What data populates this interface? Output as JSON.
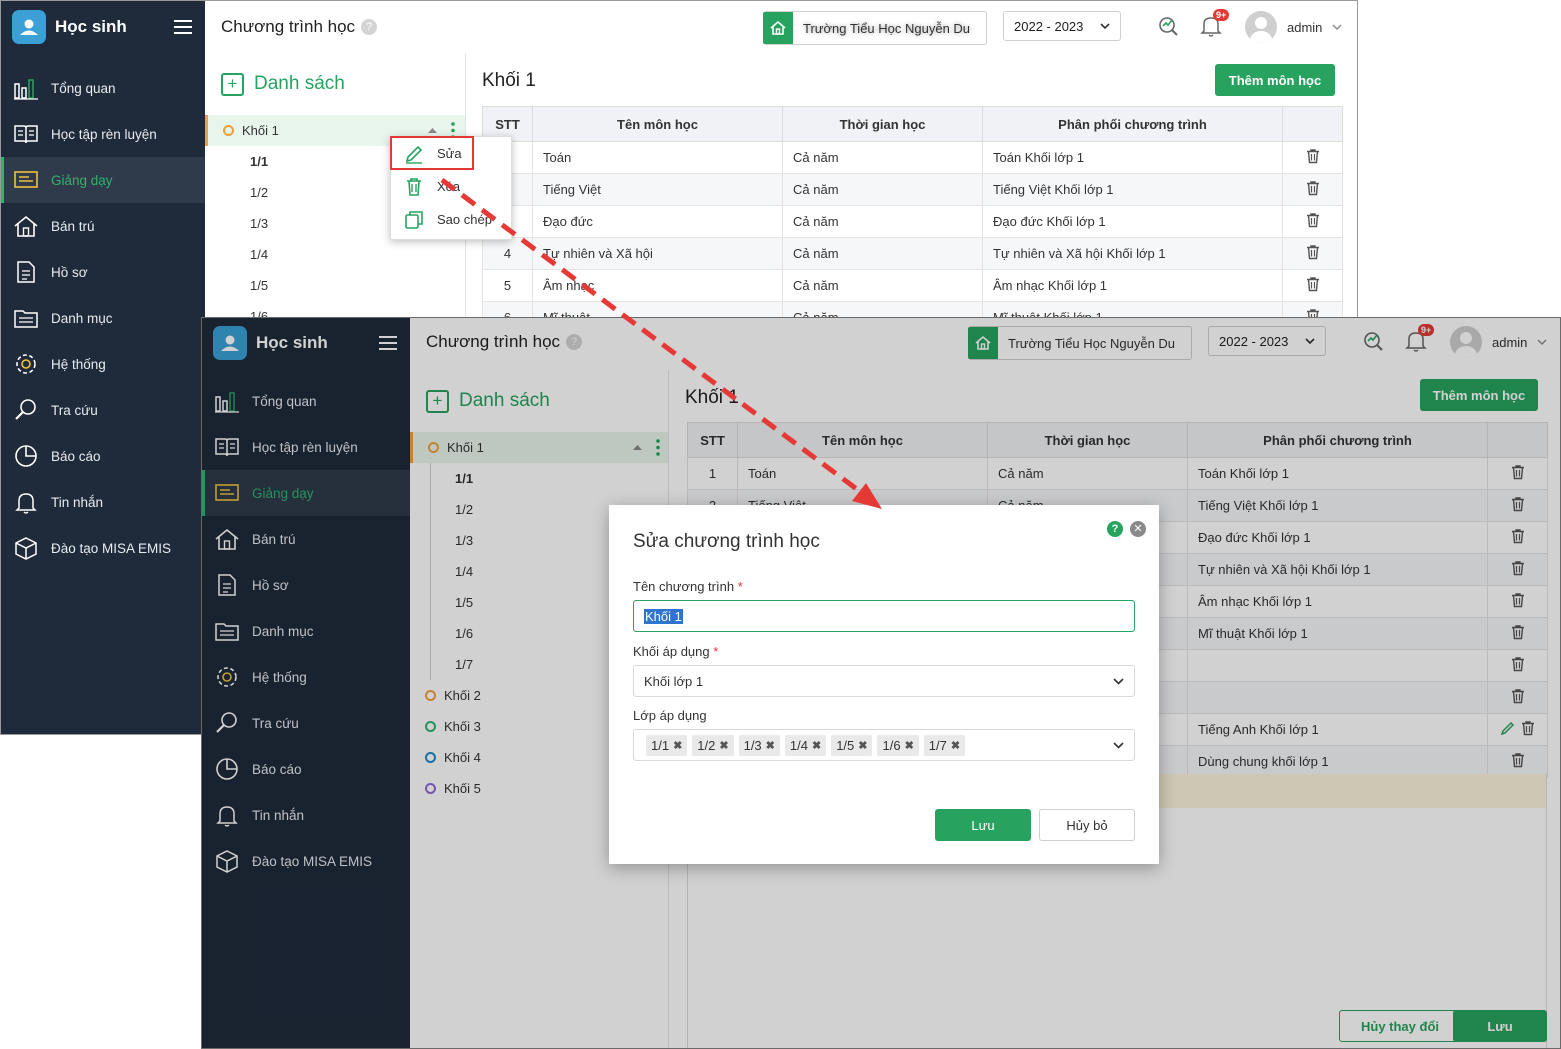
{
  "app": {
    "brand": "Học sinh",
    "page_title": "Chương trình học",
    "help_glyph": "?",
    "school_name": "Trường Tiểu Học Nguyễn Du",
    "school_year": "2022 - 2023",
    "notif_badge": "9+",
    "user": "admin"
  },
  "nav_back": [
    {
      "label": "Tổng quan",
      "icon": "chart-bars-icon"
    },
    {
      "label": "Học tập rèn luyện",
      "icon": "book-open-icon"
    },
    {
      "label": "Giảng dạy",
      "icon": "board-icon",
      "active": true
    },
    {
      "label": "Bán trú",
      "icon": "house-icon"
    },
    {
      "label": "Hồ sơ",
      "icon": "document-icon"
    },
    {
      "label": "Danh mục",
      "icon": "folder-icon"
    },
    {
      "label": "Hệ thống",
      "icon": "gear-icon"
    },
    {
      "label": "Tra cứu",
      "icon": "search-icon"
    },
    {
      "label": "Báo cáo",
      "icon": "pie-chart-icon"
    },
    {
      "label": "Tin nhắn",
      "icon": "bell-icon"
    },
    {
      "label": "Đào tạo MISA EMIS",
      "icon": "box-icon"
    }
  ],
  "tree": {
    "header": "Danh sách",
    "plus": "+",
    "selected_khoi": "Khối 1",
    "classes": [
      "1/1",
      "1/2",
      "1/3",
      "1/4",
      "1/5",
      "1/6",
      "1/7"
    ],
    "other_khoi": [
      {
        "label": "Khối 2",
        "color": "#f0a03c"
      },
      {
        "label": "Khối 3",
        "color": "#31b26f"
      },
      {
        "label": "Khối 4",
        "color": "#1e88c8"
      },
      {
        "label": "Khối 5",
        "color": "#8e6ad8"
      }
    ]
  },
  "context_menu": {
    "edit": "Sửa",
    "delete": "Xóa",
    "copy": "Sao chép"
  },
  "content": {
    "title": "Khối 1",
    "add_button": "Thêm môn học",
    "columns": [
      "STT",
      "Tên môn học",
      "Thời gian học",
      "Phân phối chương trình"
    ],
    "rows_back": [
      {
        "stt": "1",
        "name": "Toán",
        "time": "Cả năm",
        "dist": "Toán Khối lớp 1"
      },
      {
        "stt": "2",
        "name": "Tiếng Việt",
        "time": "Cả năm",
        "dist": "Tiếng Việt Khối lớp 1"
      },
      {
        "stt": "3",
        "name": "Đạo đức",
        "time": "Cả năm",
        "dist": "Đạo đức Khối lớp 1"
      },
      {
        "stt": "4",
        "name": "Tự nhiên và Xã hội",
        "time": "Cả năm",
        "dist": "Tự nhiên và Xã hội Khối lớp 1"
      },
      {
        "stt": "5",
        "name": "Âm nhạc",
        "time": "Cả năm",
        "dist": "Âm nhạc Khối lớp 1"
      },
      {
        "stt": "6",
        "name": "Mĩ thuật",
        "time": "Cả năm",
        "dist": "Mĩ thuật Khối lớp 1"
      }
    ],
    "rows_front": [
      {
        "stt": "1",
        "name": "Toán",
        "time": "Cả năm",
        "dist": "Toán Khối lớp 1"
      },
      {
        "stt": "2",
        "name": "Tiếng Việt",
        "time": "Cả năm",
        "dist": "Tiếng Việt Khối lớp 1"
      },
      {
        "stt": "",
        "name": "",
        "time": "",
        "dist": "Đạo đức Khối lớp 1"
      },
      {
        "stt": "",
        "name": "",
        "time": "",
        "dist": "Tự nhiên và Xã hội Khối lớp 1"
      },
      {
        "stt": "",
        "name": "",
        "time": "",
        "dist": "Âm nhạc Khối lớp 1"
      },
      {
        "stt": "",
        "name": "",
        "time": "",
        "dist": "Mĩ thuật Khối lớp 1"
      },
      {
        "stt": "",
        "name": "",
        "time": "",
        "dist": ""
      },
      {
        "stt": "",
        "name": "",
        "time": "",
        "dist": ""
      },
      {
        "stt": "",
        "name": "",
        "time": "",
        "dist": "Tiếng Anh Khối lớp 1"
      },
      {
        "stt": "",
        "name": "",
        "time": "",
        "dist": "Dùng chung khối lớp 1"
      }
    ],
    "cancel_changes": "Hủy thay đổi",
    "save": "Lưu"
  },
  "modal": {
    "title": "Sửa chương trình học",
    "help": "?",
    "close": "✕",
    "name_label": "Tên chương trình",
    "required_mark": "*",
    "name_value": "Khối 1",
    "grade_label": "Khối áp dụng",
    "grade_value": "Khối lớp 1",
    "class_label": "Lớp áp dụng",
    "classes": [
      "1/1",
      "1/2",
      "1/3",
      "1/4",
      "1/5",
      "1/6",
      "1/7"
    ],
    "tag_remove": "✖",
    "save": "Lưu",
    "cancel": "Hủy bỏ"
  },
  "colors": {
    "sidebar": "#1f2a3a",
    "brand_green": "#27a35f",
    "accent_orange": "#f0a03c",
    "highlight_red": "#e53935"
  }
}
